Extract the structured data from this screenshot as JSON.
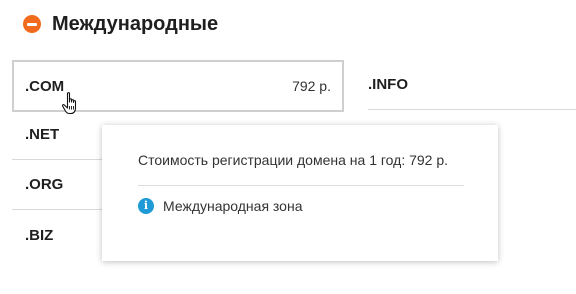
{
  "section": {
    "title": "Международные",
    "icon": "collapse-minus-icon",
    "icon_color": "#f26b1d"
  },
  "domains": {
    "com": {
      "name": ".COM",
      "price": "792 р."
    },
    "info": {
      "name": ".INFO"
    },
    "net": {
      "name": ".NET"
    },
    "org": {
      "name": ".ORG"
    },
    "biz": {
      "name": ".BIZ"
    }
  },
  "tooltip": {
    "text": "Стоимость регистрации домена на 1 год: 792 р.",
    "zone_icon": "info-icon",
    "zone_icon_glyph": "i",
    "zone_icon_color": "#1e9ad6",
    "zone": "Международная зона"
  },
  "cursor": {
    "icon": "hand-pointer-icon"
  }
}
